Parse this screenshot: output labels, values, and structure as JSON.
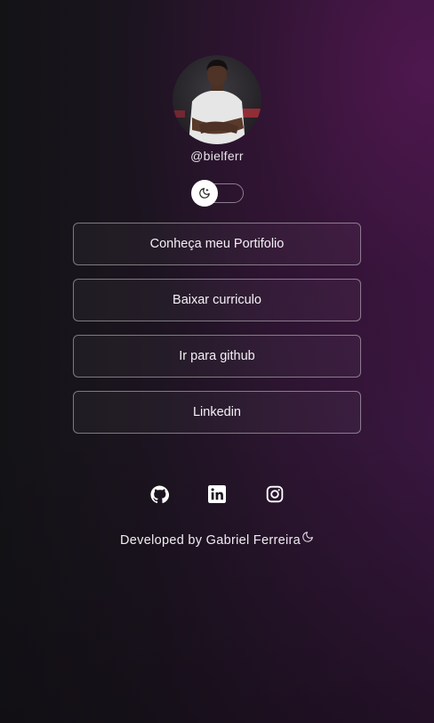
{
  "profile": {
    "username": "@bielferr"
  },
  "theme_toggle": {
    "state": "dark",
    "icon": "moon-icon"
  },
  "links": [
    {
      "label": "Conheça meu Portifolio"
    },
    {
      "label": "Baixar curriculo"
    },
    {
      "label": "Ir para github"
    },
    {
      "label": "Linkedin"
    }
  ],
  "socials": [
    {
      "icon": "github-icon"
    },
    {
      "icon": "linkedin-icon"
    },
    {
      "icon": "instagram-icon"
    }
  ],
  "footer": {
    "text": "Developed by Gabriel Ferreira",
    "icon": "moon-icon"
  },
  "colors": {
    "background_dark": "#131316",
    "background_accent": "#3a1640",
    "button_border": "#a596a8",
    "text": "#ffffff"
  }
}
